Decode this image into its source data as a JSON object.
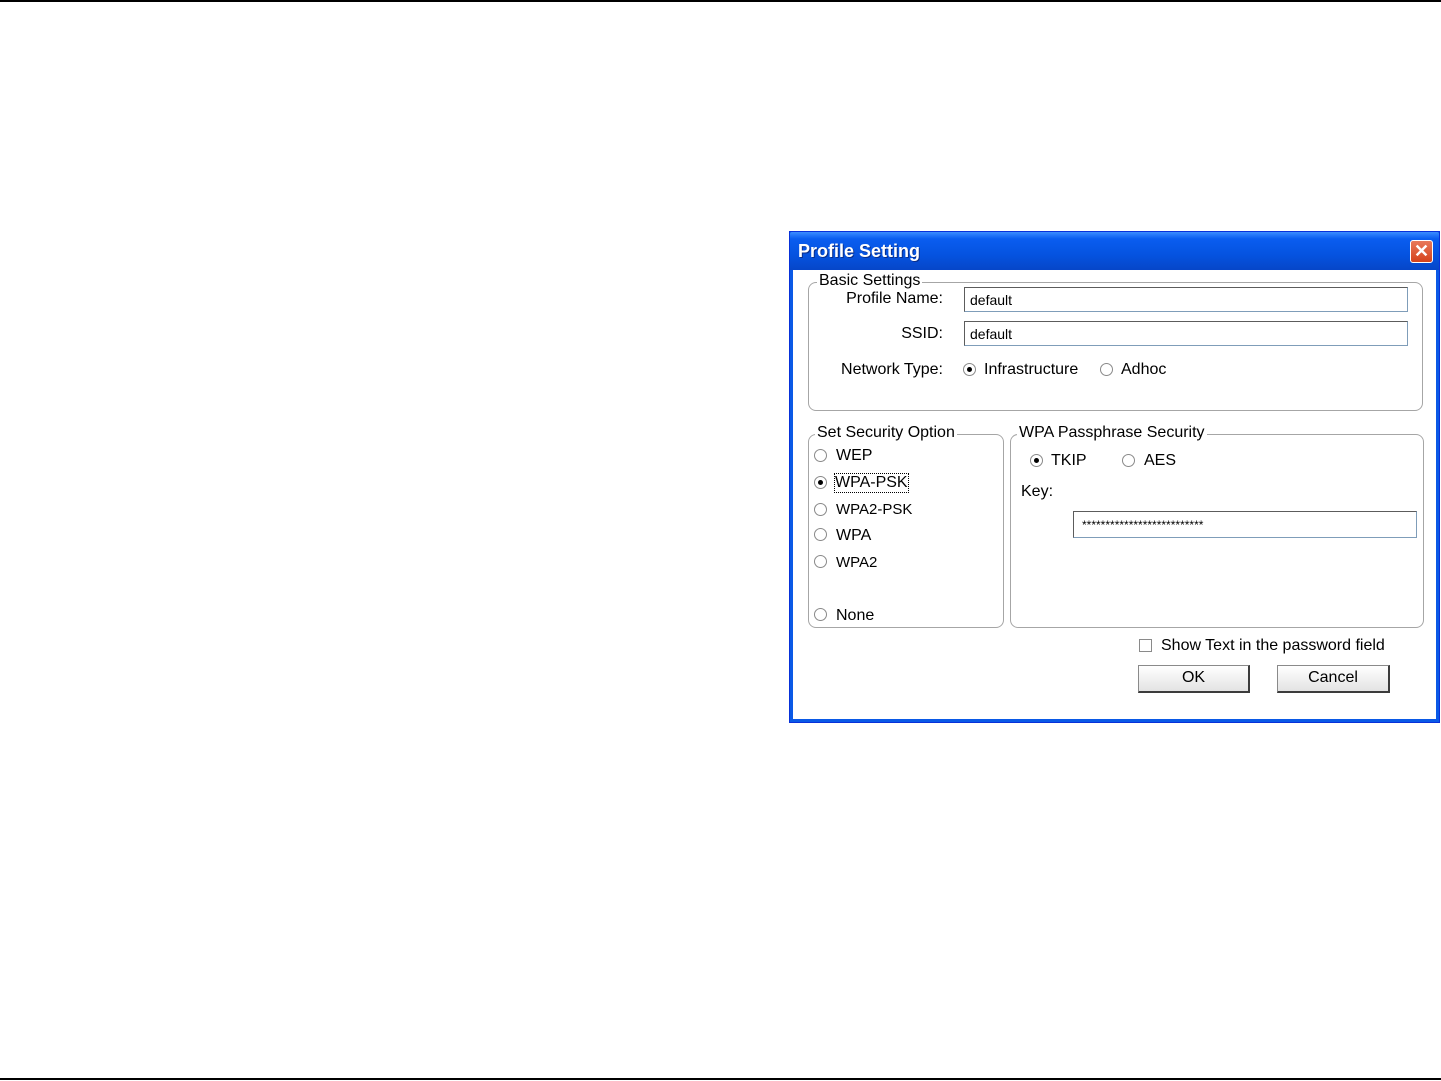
{
  "dialog": {
    "title": "Profile Setting",
    "close_glyph": "✕"
  },
  "basic": {
    "legend": "Basic Settings",
    "profile_name_label": "Profile Name:",
    "profile_name_value": "default",
    "ssid_label": "SSID:",
    "ssid_value": "default",
    "network_type_label": "Network Type:",
    "network_types": [
      "Infrastructure",
      "Adhoc"
    ],
    "network_type_selected": "Infrastructure"
  },
  "security": {
    "legend": "Set Security Option",
    "options": [
      "WEP",
      "WPA-PSK",
      "WPA2-PSK",
      "WPA",
      "WPA2",
      "None"
    ],
    "selected": "WPA-PSK"
  },
  "wpa": {
    "legend": "WPA Passphrase Security",
    "ciphers": [
      "TKIP",
      "AES"
    ],
    "cipher_selected": "TKIP",
    "key_label": "Key:",
    "key_value": "**************************"
  },
  "show_text": {
    "label": "Show Text in the password field",
    "checked": false
  },
  "buttons": {
    "ok": "OK",
    "cancel": "Cancel"
  }
}
